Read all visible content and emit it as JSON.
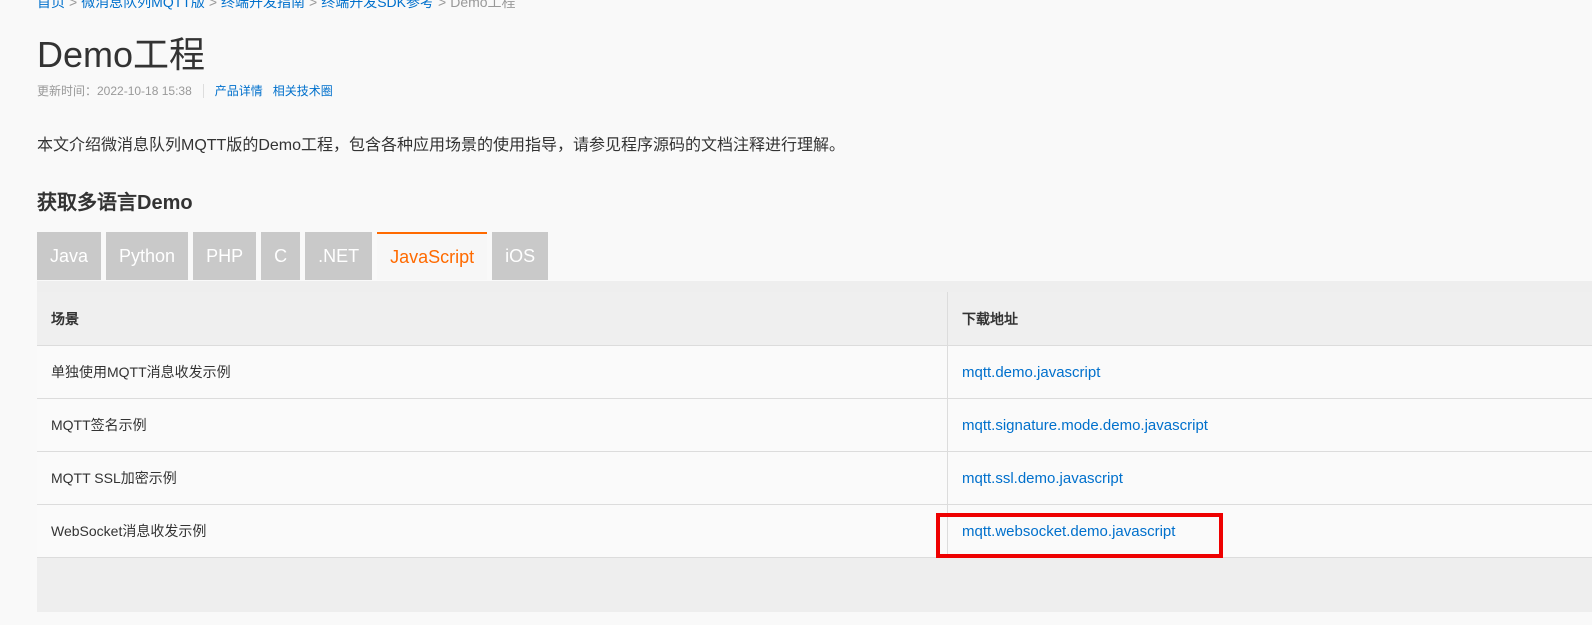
{
  "breadcrumb": {
    "items": [
      "首页",
      "微消息队列MQTT版",
      "终端开发指南",
      "终端开发SDK参考"
    ],
    "current": "Demo工程",
    "separator": ">"
  },
  "page": {
    "title": "Demo工程",
    "meta": {
      "updated": "更新时间：2022-10-18 15:38",
      "links": [
        "产品详情",
        "相关技术圈"
      ]
    },
    "intro": "本文介绍微消息队列MQTT版的Demo工程，包含各种应用场景的使用指导，请参见程序源码的文档注释进行理解。",
    "section_heading": "获取多语言Demo"
  },
  "tabs": [
    {
      "label": "Java",
      "active": false
    },
    {
      "label": "Python",
      "active": false
    },
    {
      "label": "PHP",
      "active": false
    },
    {
      "label": "C",
      "active": false
    },
    {
      "label": ".NET",
      "active": false
    },
    {
      "label": "JavaScript",
      "active": true
    },
    {
      "label": "iOS",
      "active": false
    }
  ],
  "table": {
    "headers": [
      "场景",
      "下载地址"
    ],
    "rows": [
      {
        "scene": "单独使用MQTT消息收发示例",
        "link": "mqtt.demo.javascript"
      },
      {
        "scene": "MQTT签名示例",
        "link": "mqtt.signature.mode.demo.javascript"
      },
      {
        "scene": "MQTT SSL加密示例",
        "link": "mqtt.ssl.demo.javascript"
      },
      {
        "scene": "WebSocket消息收发示例",
        "link": "mqtt.websocket.demo.javascript"
      }
    ]
  },
  "colors": {
    "link": "#0070cc",
    "active_tab": "#ff6a00",
    "highlight": "#ee0000"
  }
}
